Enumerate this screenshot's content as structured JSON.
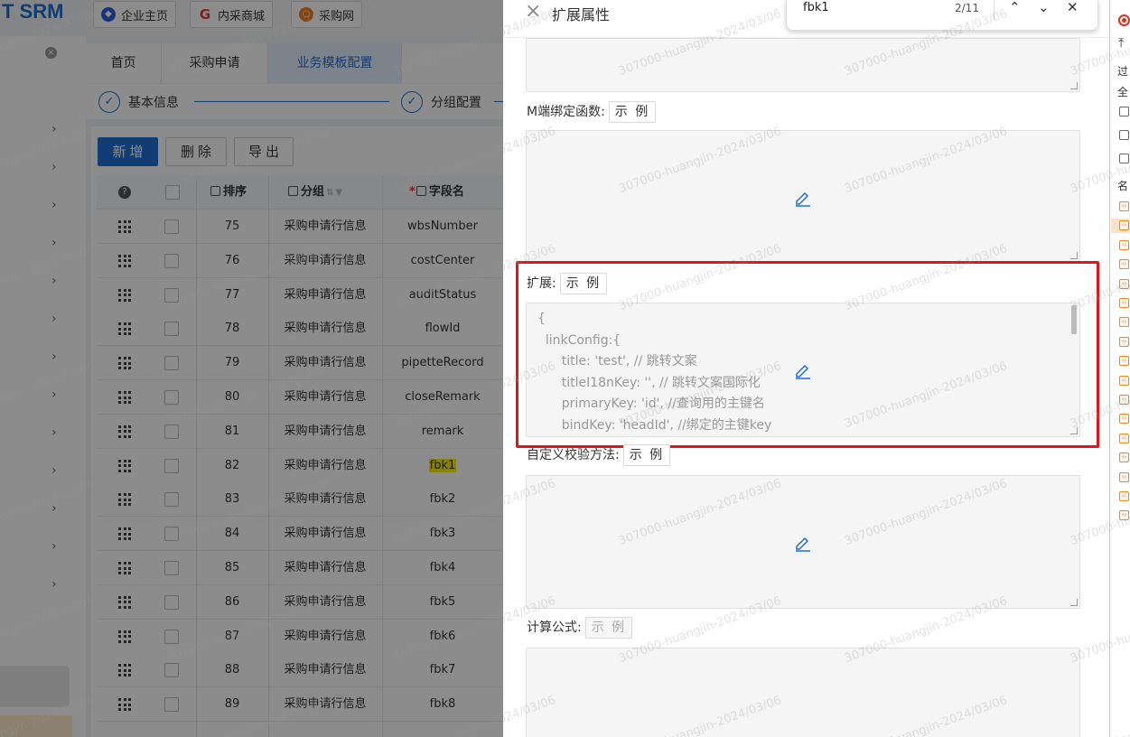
{
  "app": {
    "brand": "T SRM",
    "top_links": [
      {
        "label": "企业主页",
        "icon": "building-icon",
        "color": "#2a5bd7"
      },
      {
        "label": "内采商城",
        "icon": "g-logo-icon",
        "color": "#e33b3b"
      },
      {
        "label": "采购网",
        "icon": "q-logo-icon",
        "color": "#f07c1c"
      }
    ],
    "tabs": [
      "首页",
      "采购申请",
      "业务模板配置"
    ],
    "steps": [
      {
        "label": "基本信息",
        "mark": "✓"
      },
      {
        "label": "分组配置",
        "mark": "✓"
      }
    ],
    "toolbar": {
      "add": "新增",
      "delete": "删除",
      "export": "导出"
    },
    "columns": {
      "help": "?",
      "sort": "排序",
      "group": "分组",
      "field": "字段名"
    },
    "rows": [
      {
        "sort": "75",
        "group": "采购申请行信息",
        "field": "wbsNumber"
      },
      {
        "sort": "76",
        "group": "采购申请行信息",
        "field": "costCenter"
      },
      {
        "sort": "77",
        "group": "采购申请行信息",
        "field": "auditStatus"
      },
      {
        "sort": "78",
        "group": "采购申请行信息",
        "field": "flowId"
      },
      {
        "sort": "79",
        "group": "采购申请行信息",
        "field": "pipetteRecord"
      },
      {
        "sort": "80",
        "group": "采购申请行信息",
        "field": "closeRemark"
      },
      {
        "sort": "81",
        "group": "采购申请行信息",
        "field": "remark"
      },
      {
        "sort": "82",
        "group": "采购申请行信息",
        "field": "fbk1",
        "highlight": true
      },
      {
        "sort": "83",
        "group": "采购申请行信息",
        "field": "fbk2"
      },
      {
        "sort": "84",
        "group": "采购申请行信息",
        "field": "fbk3"
      },
      {
        "sort": "85",
        "group": "采购申请行信息",
        "field": "fbk4"
      },
      {
        "sort": "86",
        "group": "采购申请行信息",
        "field": "fbk5"
      },
      {
        "sort": "87",
        "group": "采购申请行信息",
        "field": "fbk6"
      },
      {
        "sort": "88",
        "group": "采购申请行信息",
        "field": "fbk7"
      },
      {
        "sort": "89",
        "group": "采购申请行信息",
        "field": "fbk8"
      }
    ]
  },
  "drawer": {
    "title": "扩展属性",
    "close_icon": "×",
    "m_bind_label": "M端绑定函数:",
    "example_label": "示 例",
    "extend_label": "扩展:",
    "extend_code": [
      "{",
      "  linkConfig:{",
      "      title: 'test', // 跳转文案",
      "      titleI18nKey: '', // 跳转文案国际化",
      "      primaryKey: 'id', //查询用的主键名",
      "      bindKey: 'headId', //绑定的主键key"
    ],
    "validate_label": "自定义校验方法:",
    "formula_label": "计算公式:"
  },
  "findbar": {
    "query": "fbk1",
    "count": "2/11",
    "prev": "⌃",
    "next": "⌄",
    "close": "✕"
  },
  "devtools": {
    "filter": "过",
    "all": "全",
    "name_col": "名"
  },
  "watermark": "307000-huangjin-2024/03/06",
  "colors": {
    "primary": "#1f6fd6",
    "highlight_box": "#e3141e",
    "search_highlight": "#f2f200"
  }
}
